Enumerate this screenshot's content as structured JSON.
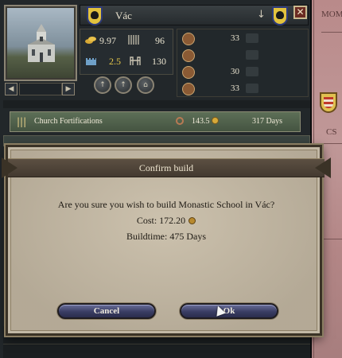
{
  "province": {
    "name": "Vác",
    "close_glyph": "✕",
    "arrow_glyph": "↓"
  },
  "stats": {
    "gold": "9.97",
    "levy": "96",
    "tax": "2.5",
    "garrison": "130"
  },
  "levies": [
    "33",
    "",
    "30",
    "33"
  ],
  "building": {
    "name": "Church Fortifications",
    "cost": "143.5",
    "time": "317 Days",
    "icon": "|||"
  },
  "map": {
    "labels": [
      "MOM",
      "CS"
    ]
  },
  "dialog": {
    "title": "Confirm build",
    "question": "Are you sure you wish to build Monastic School in Vác?",
    "cost": "Cost: 172.20",
    "buildtime": "Buildtime: 475 Days",
    "cancel": "Cancel",
    "ok": "Ok"
  },
  "nav": {
    "prev": "◀",
    "next": "▶"
  },
  "actions": [
    "↑",
    "↑",
    "⌂"
  ]
}
